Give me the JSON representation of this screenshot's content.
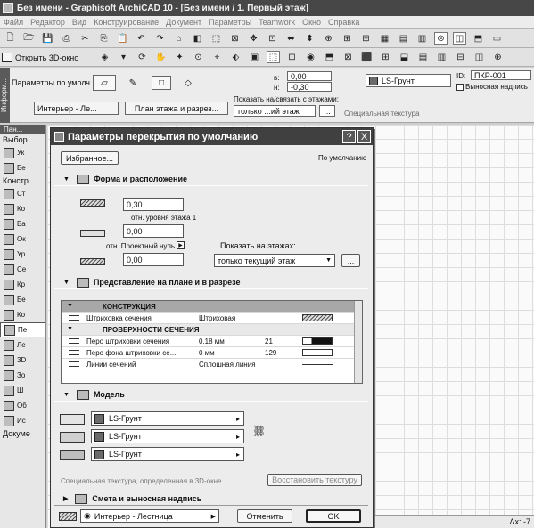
{
  "window": {
    "title": "Без имени - Graphisoft ArchiCAD 10 - [Без имени / 1. Первый этаж]"
  },
  "menu": [
    "Файл",
    "Редактор",
    "Вид",
    "Конструирование",
    "Документ",
    "Параметры",
    "Teamwork",
    "Окно",
    "Справка"
  ],
  "toolbar2": {
    "open3d": "Открыть 3D-окно"
  },
  "infobox": {
    "tab": "Информ...",
    "default_params": "Параметры по умолч.",
    "field_top": "0,00",
    "field_bottom": "-0,30",
    "label_top": "в:",
    "label_bottom": "н:",
    "material": "LS-Грунт",
    "id_label": "ID:",
    "id_value": "ПКР-001",
    "leader_label": "Выносная надпись",
    "interior": "Интерьер - Ле...",
    "plan_section": "План этажа и разрез...",
    "show_on": "Показать на/связать с этажами:",
    "show_value": "только ...ий этаж",
    "dots": "...",
    "special_texture": "Специальная текстура"
  },
  "toolbox": {
    "header": "Пан...",
    "sections": [
      "Выбор",
      "Констр",
      "Докуме"
    ],
    "select_items": [
      "Ук",
      "Бе"
    ],
    "construct_items": [
      "Ст",
      "Ко",
      "Ба",
      "Ок",
      "Ур",
      "Се",
      "Кр",
      "Бе",
      "Ко",
      "Пе",
      "Ле",
      "3D",
      "Зо",
      "Ш",
      "Об",
      "Ис"
    ]
  },
  "dialog": {
    "title": "Параметры перекрытия по умолчанию",
    "help": "?",
    "close": "X",
    "favorites": "Избранное...",
    "defaults": "По умолчанию",
    "sec_shape": "Форма и расположение",
    "thickness": "0,30",
    "rel_level": "отн. уровня этажа 1",
    "offset": "0,00",
    "rel_zero": "отн. Проектный нуль",
    "elevation": "0,00",
    "show_on_floors": "Показать на этажах:",
    "floors_value": "только текущий этаж",
    "dots": "...",
    "sec_plan": "Представление на плане и в разрезе",
    "table": [
      {
        "type": "hdr",
        "name": "КОНСТРУКЦИЯ",
        "value": "",
        "num": ""
      },
      {
        "type": "row",
        "name": "Штриховка сечения",
        "value": "Штриховая",
        "num": ""
      },
      {
        "type": "hdr2",
        "name": "ПРОВЕРХНОСТИ СЕЧЕНИЯ",
        "value": "",
        "num": ""
      },
      {
        "type": "row",
        "name": "Перо штриховки сечения",
        "value": "0.18 мм",
        "num": "21"
      },
      {
        "type": "row",
        "name": "Перо фона штриховки се...",
        "value": "0 мм",
        "num": "129"
      },
      {
        "type": "row",
        "name": "Линии сечений",
        "value": "Сплошная линия",
        "num": ""
      }
    ],
    "sec_model": "Модель",
    "materials": [
      "LS-Грунт",
      "LS-Грунт",
      "LS-Грунт"
    ],
    "special_texture_note": "Специальная текстура, определенная в 3D-окне.",
    "restore_texture": "Восстановить текстуру",
    "sec_listing": "Смета и выносная надпись",
    "layer": "Интерьер - Лестница",
    "cancel": "Отменить",
    "ok": "OK"
  },
  "coordbar": {
    "text": "Δx: -7"
  }
}
